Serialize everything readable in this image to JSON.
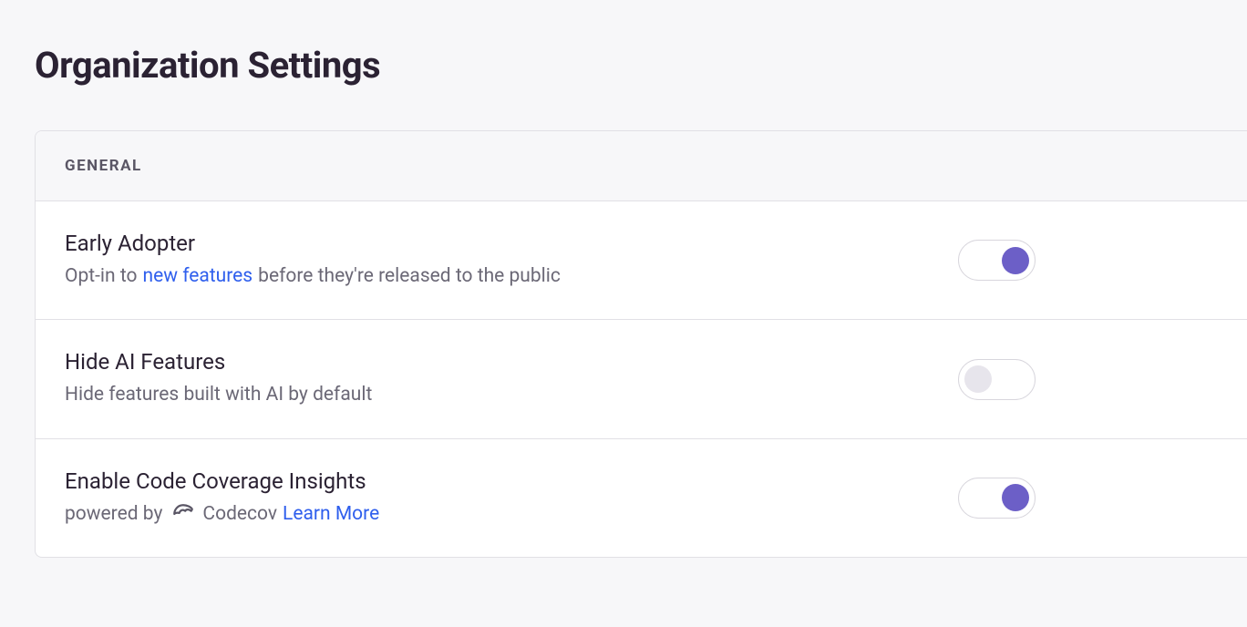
{
  "page": {
    "title": "Organization Settings"
  },
  "panel": {
    "header": "General",
    "settings": [
      {
        "title": "Early Adopter",
        "desc_prefix": "Opt-in to ",
        "link_text": "new features",
        "desc_suffix": " before they're released to the public",
        "toggle_on": true
      },
      {
        "title": "Hide AI Features",
        "desc_prefix": "Hide features built with AI by default",
        "link_text": "",
        "desc_suffix": "",
        "toggle_on": false
      },
      {
        "title": "Enable Code Coverage Insights",
        "desc_prefix": "powered by",
        "brand": "Codecov",
        "link_text": "Learn More",
        "desc_suffix": "",
        "toggle_on": true
      }
    ]
  }
}
